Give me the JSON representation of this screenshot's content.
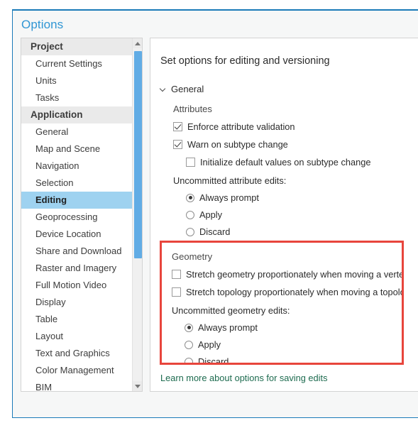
{
  "dialog": {
    "title": "Options"
  },
  "nav": {
    "scrollbar": {
      "up_arrow_icon": "triangle-up-icon",
      "down_arrow_icon": "triangle-down-icon"
    },
    "groups": [
      {
        "label": "Project",
        "items": [
          {
            "label": "Current Settings",
            "selected": false
          },
          {
            "label": "Units",
            "selected": false
          },
          {
            "label": "Tasks",
            "selected": false
          }
        ]
      },
      {
        "label": "Application",
        "items": [
          {
            "label": "General",
            "selected": false
          },
          {
            "label": "Map and Scene",
            "selected": false
          },
          {
            "label": "Navigation",
            "selected": false
          },
          {
            "label": "Selection",
            "selected": false
          },
          {
            "label": "Editing",
            "selected": true
          },
          {
            "label": "Geoprocessing",
            "selected": false
          },
          {
            "label": "Device Location",
            "selected": false
          },
          {
            "label": "Share and Download",
            "selected": false
          },
          {
            "label": "Raster and Imagery",
            "selected": false
          },
          {
            "label": "Full Motion Video",
            "selected": false
          },
          {
            "label": "Display",
            "selected": false
          },
          {
            "label": "Table",
            "selected": false
          },
          {
            "label": "Layout",
            "selected": false
          },
          {
            "label": "Text and Graphics",
            "selected": false
          },
          {
            "label": "Color Management",
            "selected": false
          },
          {
            "label": "BIM",
            "selected": false
          }
        ]
      }
    ]
  },
  "content": {
    "heading": "Set options for editing and versioning",
    "general": {
      "label": "General",
      "expanded_icon": "chevron-down-icon",
      "attributes": {
        "label": "Attributes",
        "checkboxes": [
          {
            "label": "Enforce attribute validation",
            "checked": true,
            "indent": 0
          },
          {
            "label": "Warn on subtype change",
            "checked": true,
            "indent": 0
          },
          {
            "label": "Initialize default values on subtype change",
            "checked": false,
            "indent": 1
          }
        ],
        "uncommitted_label": "Uncommitted attribute edits:",
        "radios": [
          {
            "label": "Always prompt",
            "selected": true
          },
          {
            "label": "Apply",
            "selected": false
          },
          {
            "label": "Discard",
            "selected": false
          }
        ]
      },
      "geometry": {
        "label": "Geometry",
        "highlight_color": "#e8453c",
        "checkboxes": [
          {
            "label": "Stretch geometry proportionately when moving a vertex",
            "checked": false
          },
          {
            "label": "Stretch topology proportionately when moving a topology element",
            "checked": false
          }
        ],
        "uncommitted_label": "Uncommitted geometry edits:",
        "radios": [
          {
            "label": "Always prompt",
            "selected": true
          },
          {
            "label": "Apply",
            "selected": false
          },
          {
            "label": "Discard",
            "selected": false
          }
        ]
      }
    },
    "learn_more": "Learn more about options for saving edits"
  }
}
